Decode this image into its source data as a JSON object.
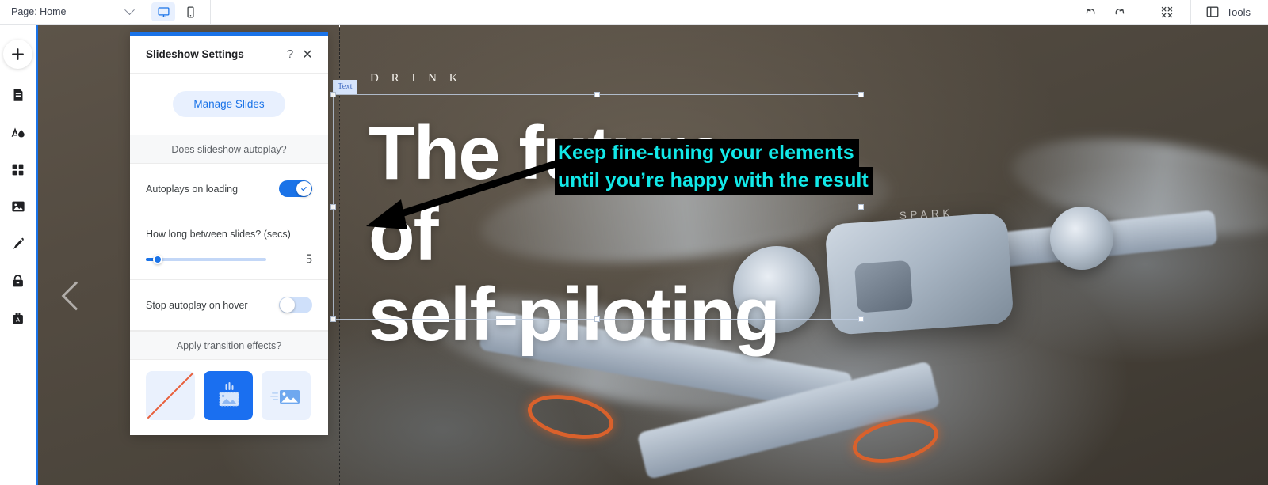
{
  "topbar": {
    "page_select": {
      "label": "Page: Home",
      "icon": "chevron-down-icon"
    },
    "devices": [
      {
        "name": "desktop",
        "icon": "desktop-monitor-icon",
        "active": true
      },
      {
        "name": "mobile",
        "icon": "mobile-phone-icon",
        "active": false
      }
    ],
    "undo": {
      "icon": "undo-arrow-icon"
    },
    "redo": {
      "icon": "redo-arrow-icon"
    },
    "collapse": {
      "icon": "collapse-fullscreen-icon"
    },
    "tools": {
      "label": "Tools",
      "icon": "panel-layout-icon"
    }
  },
  "sidebar": {
    "add_button": {
      "icon": "plus-icon",
      "label": "+"
    },
    "items": [
      {
        "name": "pages",
        "icon": "page-document-icon"
      },
      {
        "name": "theme",
        "icon": "font-color-droplet-icon"
      },
      {
        "name": "apps",
        "icon": "grid-apps-icon"
      },
      {
        "name": "media",
        "icon": "image-picture-icon"
      },
      {
        "name": "blog",
        "icon": "fountain-pen-icon"
      },
      {
        "name": "members",
        "icon": "lock-padlock-icon"
      },
      {
        "name": "seo",
        "icon": "briefcase-a-icon"
      }
    ]
  },
  "panel": {
    "title": "Slideshow Settings",
    "help_icon": "question-mark-icon",
    "close_icon": "close-x-icon",
    "manage_slides_label": "Manage Slides",
    "section_autoplay": "Does slideshow autoplay?",
    "autoplay_row": {
      "label": "Autoplays on loading",
      "toggle_state": "on",
      "toggle_icon": "checkmark-icon"
    },
    "slider": {
      "label": "How long between slides? (secs)",
      "value": "5",
      "min": 0,
      "max": 60,
      "fill_percent": 8
    },
    "hover_row": {
      "label": "Stop autoplay on hover",
      "toggle_state": "off",
      "toggle_icon": "dash-icon"
    },
    "section_transition": "Apply transition effects?",
    "transitions": [
      {
        "name": "none",
        "icon": "diagonal-slash-icon",
        "selected": false
      },
      {
        "name": "fade",
        "icon": "image-fade-icon",
        "selected": true
      },
      {
        "name": "slide",
        "icon": "image-slide-icon",
        "selected": false
      }
    ]
  },
  "canvas": {
    "eyebrow": "D R I N K",
    "headline_line1": "The future",
    "headline_line2": "of",
    "headline_line3": "self-piloting",
    "selection_tag": "Text",
    "prev_arrow_icon": "chevron-left-icon",
    "product_label": "SPARK"
  },
  "annotation": {
    "line1": "Keep fine-tuning your elements",
    "line2": "until you’re happy with the result",
    "text_color": "#12e8e8",
    "background_color": "#000000",
    "arrow_icon": "pointer-arrow-icon"
  }
}
